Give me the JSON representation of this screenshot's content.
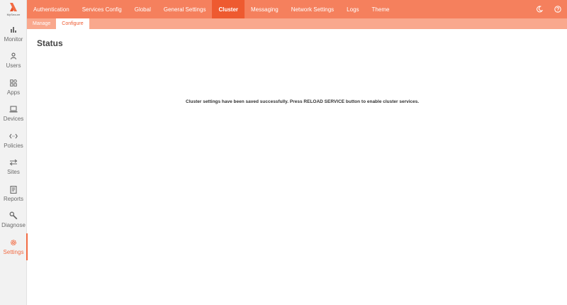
{
  "brand": {
    "name": "MySecure",
    "accent": "#f26b43"
  },
  "sidebar": {
    "items": [
      {
        "label": "Monitor",
        "icon": "bar-chart-icon"
      },
      {
        "label": "Users",
        "icon": "user-icon"
      },
      {
        "label": "Apps",
        "icon": "apps-grid-icon"
      },
      {
        "label": "Devices",
        "icon": "laptop-icon"
      },
      {
        "label": "Policies",
        "icon": "code-arrows-icon"
      },
      {
        "label": "Sites",
        "icon": "swap-arrows-icon"
      },
      {
        "label": "Reports",
        "icon": "report-icon"
      },
      {
        "label": "Diagnose",
        "icon": "wrench-icon"
      },
      {
        "label": "Settings",
        "icon": "gear-icon",
        "active": true
      }
    ]
  },
  "topnav": {
    "tabs": [
      "Authentication",
      "Services Config",
      "Global",
      "General Settings",
      "Cluster",
      "Messaging",
      "Network Settings",
      "Logs",
      "Theme"
    ],
    "active": "Cluster"
  },
  "subnav": {
    "tabs": [
      "Manage",
      "Configure"
    ],
    "active": "Configure"
  },
  "main": {
    "title": "Status",
    "message": "Cluster settings have been saved successfully. Press RELOAD SERVICE button to enable cluster services."
  }
}
